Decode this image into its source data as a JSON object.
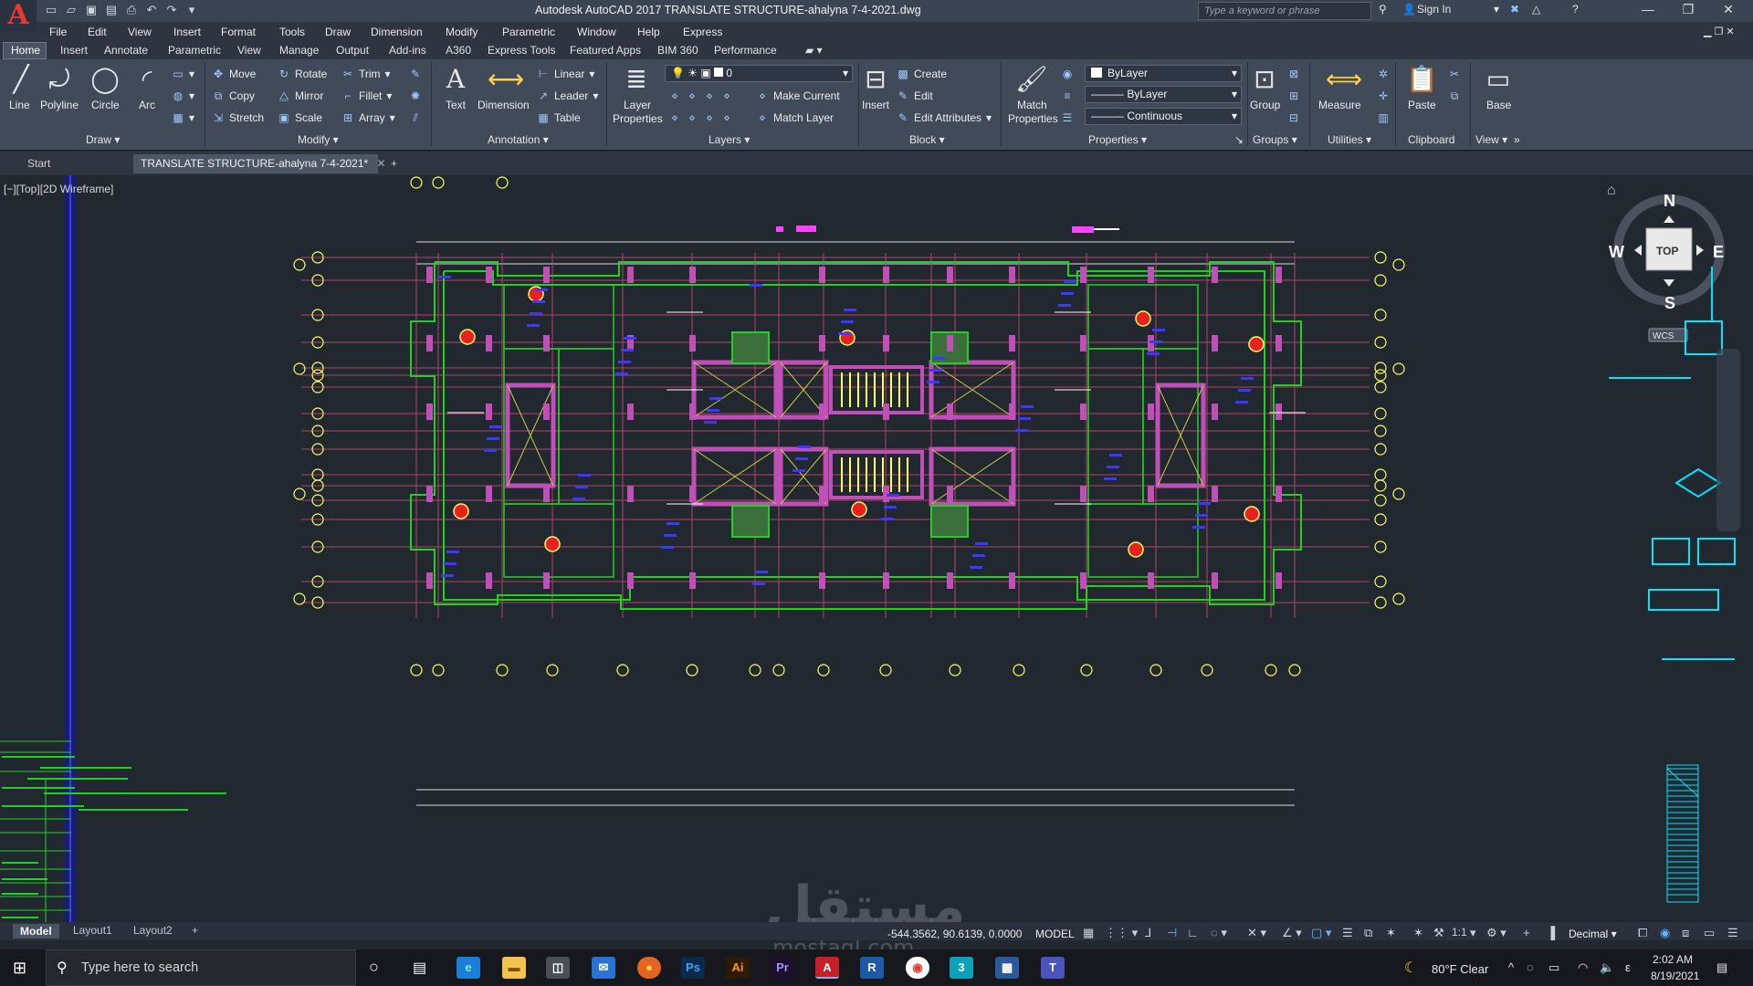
{
  "window": {
    "title": "Autodesk AutoCAD 2017   TRANSLATE STRUCTURE-ahalyna 7-4-2021.dwg",
    "search_placeholder": "Type a keyword or phrase",
    "sign_in": "Sign In"
  },
  "menu": [
    "File",
    "Edit",
    "View",
    "Insert",
    "Format",
    "Tools",
    "Draw",
    "Dimension",
    "Modify",
    "Parametric",
    "Window",
    "Help",
    "Express"
  ],
  "ribbon_tabs": [
    "Home",
    "Insert",
    "Annotate",
    "Parametric",
    "View",
    "Manage",
    "Output",
    "Add-ins",
    "A360",
    "Express Tools",
    "Featured Apps",
    "BIM 360",
    "Performance"
  ],
  "ribbon": {
    "draw": {
      "title": "Draw",
      "line": "Line",
      "polyline": "Polyline",
      "circle": "Circle",
      "arc": "Arc"
    },
    "modify": {
      "title": "Modify",
      "move": "Move",
      "rotate": "Rotate",
      "trim": "Trim",
      "copy": "Copy",
      "mirror": "Mirror",
      "fillet": "Fillet",
      "stretch": "Stretch",
      "scale": "Scale",
      "array": "Array"
    },
    "annotation": {
      "title": "Annotation",
      "text": "Text",
      "dimension": "Dimension",
      "linear": "Linear",
      "leader": "Leader",
      "table": "Table"
    },
    "layers": {
      "title": "Layers",
      "layer_properties_1": "Layer",
      "layer_properties_2": "Properties",
      "current_layer": "0",
      "make_current": "Make Current",
      "match_layer": "Match Layer"
    },
    "block": {
      "title": "Block",
      "insert": "Insert",
      "create": "Create",
      "edit": "Edit",
      "edit_attributes": "Edit Attributes"
    },
    "properties": {
      "title": "Properties",
      "match_1": "Match",
      "match_2": "Properties",
      "color": "ByLayer",
      "lineweight": "ByLayer",
      "linetype": "Continuous"
    },
    "groups": {
      "title": "Groups",
      "group": "Group"
    },
    "utilities": {
      "title": "Utilities",
      "measure": "Measure"
    },
    "clipboard": {
      "title": "Clipboard",
      "paste": "Paste"
    },
    "view": {
      "title": "View",
      "base": "Base"
    }
  },
  "file_tabs": {
    "start": "Start",
    "active": "TRANSLATE STRUCTURE-ahalyna 7-4-2021*"
  },
  "viewport": {
    "label": "[−][Top][2D Wireframe]",
    "viewcube": {
      "n": "N",
      "s": "S",
      "e": "E",
      "w": "W",
      "top": "TOP",
      "wcs": "WCS"
    }
  },
  "layout_tabs": [
    "Model",
    "Layout1",
    "Layout2"
  ],
  "status": {
    "coords": "-544.3562, 90.6139, 0.0000",
    "space": "MODEL",
    "scale": "1:1",
    "units": "Decimal"
  },
  "taskbar": {
    "search_placeholder": "Type here to search",
    "weather": "80°F  Clear",
    "time": "2:02 AM",
    "date": "8/19/2021"
  },
  "watermark": {
    "main": "مستقل",
    "sub": "mostaql.com"
  },
  "colors": {
    "bg": "#212830",
    "wall": "#1fd21f",
    "column": "#c04fb8",
    "dim": "#ffff66",
    "grid": "#b44466",
    "red_dot": "#e82020"
  }
}
